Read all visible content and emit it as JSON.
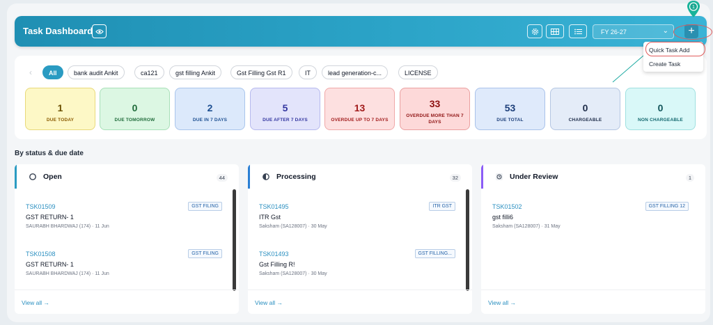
{
  "header": {
    "title": "Task Dashboard",
    "fiscal_year": "FY 26-27",
    "step_marker": "1"
  },
  "add_menu": {
    "items": [
      "Quick Task Add",
      "Create Task"
    ]
  },
  "filters": [
    "All",
    "bank audit Ankit",
    "ca121",
    "gst filling Ankit",
    "Gst Filling Gst R1",
    "IT",
    "lead generation-c...",
    "LICENSE"
  ],
  "stats": [
    {
      "value": "1",
      "label": "DUE TODAY",
      "bg": "#fdf8c6",
      "border": "#e8d97a",
      "color": "#6b4f00",
      "labelColor": "#8a5a00"
    },
    {
      "value": "0",
      "label": "DUE TOMORROW",
      "bg": "#dcf7e3",
      "border": "#a8e0b8",
      "color": "#1f6b3a",
      "labelColor": "#1f6b3a"
    },
    {
      "value": "2",
      "label": "DUE IN 7 DAYS",
      "bg": "#dce9fb",
      "border": "#a9c5ec",
      "color": "#1d4f91",
      "labelColor": "#1d4f91"
    },
    {
      "value": "5",
      "label": "DUE AFTER 7 DAYS",
      "bg": "#e3e4fb",
      "border": "#b6b9ee",
      "color": "#3336a0",
      "labelColor": "#3336a0"
    },
    {
      "value": "13",
      "label": "OVERDUE UP TO 7 DAYS",
      "bg": "#fde0e0",
      "border": "#f0a8a8",
      "color": "#a11a1a",
      "labelColor": "#a11a1a"
    },
    {
      "value": "33",
      "label": "OVERDUE MORE THAN 7 DAYS",
      "bg": "#fdd9d9",
      "border": "#eaa0a0",
      "color": "#8e1212",
      "labelColor": "#8e1212"
    },
    {
      "value": "53",
      "label": "DUE TOTAL",
      "bg": "#dfeafb",
      "border": "#a9c2ea",
      "color": "#1d3f7a",
      "labelColor": "#1d3f7a"
    },
    {
      "value": "0",
      "label": "CHARGEABLE",
      "bg": "#e4ecf8",
      "border": "#b4c6e2",
      "color": "#1f2d4a",
      "labelColor": "#1f2d4a"
    },
    {
      "value": "0",
      "label": "NON CHARGEABLE",
      "bg": "#d9f8f8",
      "border": "#9fe0e0",
      "color": "#11545a",
      "labelColor": "#11666d"
    }
  ],
  "section_title": "By status & due date",
  "columns": [
    {
      "title": "Open",
      "count": "44",
      "accent": "#2a9bc2",
      "tasks": [
        {
          "id": "TSK01509",
          "tag": "GST FILING",
          "name": "GST RETURN- 1",
          "meta": "SAURABH BHARDWAJ (174) · 11 Jun"
        },
        {
          "id": "TSK01508",
          "tag": "GST FILING",
          "name": "GST RETURN- 1",
          "meta": "SAURABH BHARDWAJ (174) · 11 Jun"
        }
      ],
      "view_all": "View all →"
    },
    {
      "title": "Processing",
      "count": "32",
      "accent": "#2a7fd4",
      "tasks": [
        {
          "id": "TSK01495",
          "tag": "ITR GST",
          "name": "ITR Gst",
          "meta": "Saksham (SA128007) · 30 May"
        },
        {
          "id": "TSK01493",
          "tag": "GST FILLING...",
          "name": "Gst Filling R!",
          "meta": "Saksham (SA128007) · 30 May"
        }
      ],
      "view_all": "View all →"
    },
    {
      "title": "Under Review",
      "count": "1",
      "accent": "#8b5cf6",
      "tasks": [
        {
          "id": "TSK01502",
          "tag": "GST FILLING 12",
          "name": "gst filli6",
          "meta": "Saksham (SA128007) · 31 May"
        }
      ],
      "view_all": "View all →"
    }
  ]
}
